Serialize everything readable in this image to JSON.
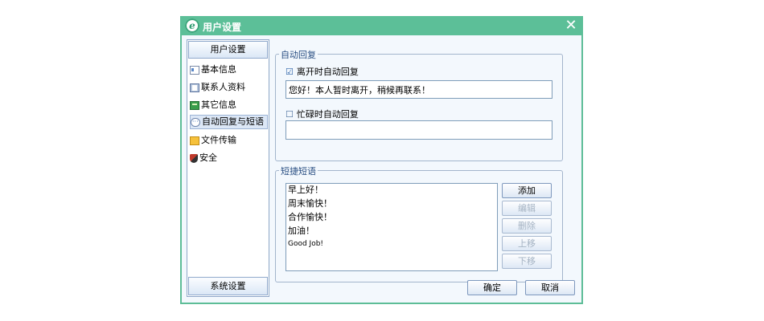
{
  "window": {
    "title": "用户设置",
    "app_icon_glyph": "e",
    "close_glyph": "✕"
  },
  "sidebar": {
    "header": "用户设置",
    "items": [
      {
        "label": "基本信息",
        "icon": "card-icon"
      },
      {
        "label": "联系人资料",
        "icon": "contact-icon"
      },
      {
        "label": "其它信息",
        "icon": "book-icon"
      },
      {
        "label": "自动回复与短语",
        "icon": "bubble-icon",
        "selected": true
      },
      {
        "label": "文件传输",
        "icon": "folder-icon"
      },
      {
        "label": "安全",
        "icon": "shield-icon"
      }
    ],
    "footer": "系统设置"
  },
  "auto_reply": {
    "legend": "自动回复",
    "away": {
      "label": "离开时自动回复",
      "checked": true,
      "check_glyph": "☑",
      "value": "您好！本人暂时离开，稍候再联系！"
    },
    "busy": {
      "label": "忙碌时自动回复",
      "checked": false,
      "check_glyph": "☐",
      "value": ""
    }
  },
  "phrases": {
    "legend": "短捷短语",
    "items": [
      "早上好！",
      "周末愉快！",
      "合作愉快！",
      "加油！",
      "Good Job!"
    ],
    "buttons": {
      "add": "添加",
      "edit": "编辑",
      "delete": "删除",
      "up": "上移",
      "down": "下移"
    }
  },
  "footer": {
    "ok": "确定",
    "cancel": "取消"
  },
  "colors": {
    "titlebar": "#5cbf98",
    "client_bg": "#f3f8fd",
    "border": "#7f9db9"
  }
}
